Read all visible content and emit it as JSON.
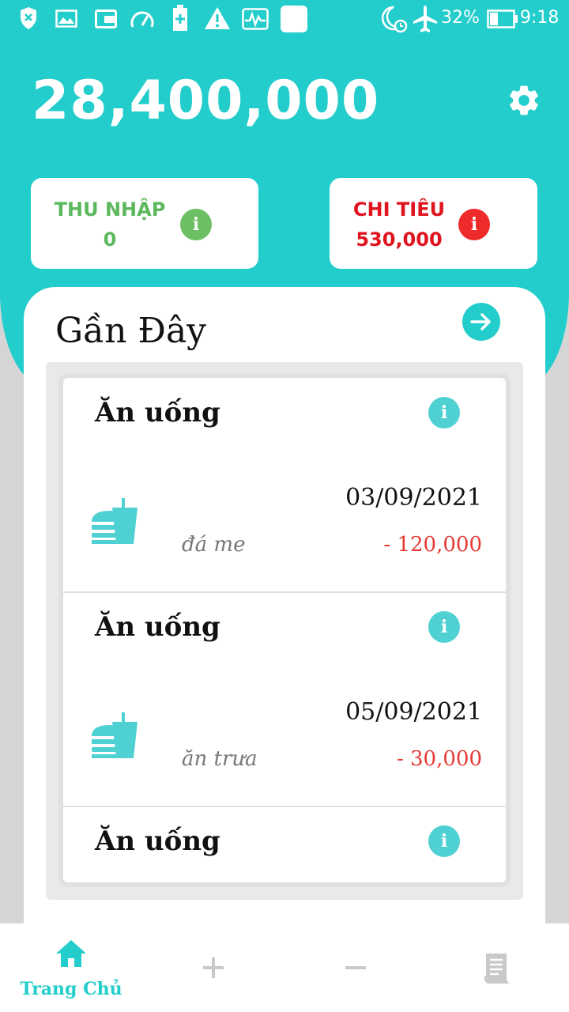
{
  "status_bar": {
    "battery_percent": "32%",
    "time": "9:18"
  },
  "balance": "28,400,000",
  "summary": {
    "income_label": "THU NHẬP",
    "income_value": "0",
    "income_color": "#5cb85c",
    "expense_label": "CHI TIÊU",
    "expense_value": "530,000",
    "expense_color": "#e0141e"
  },
  "recent": {
    "title": "Gần Đây",
    "items": [
      {
        "category": "Ăn uống",
        "date": "03/09/2021",
        "note": "đá me",
        "amount": "- 120,000"
      },
      {
        "category": "Ăn uống",
        "date": "05/09/2021",
        "note": "ăn trưa",
        "amount": "- 30,000"
      },
      {
        "category": "Ăn uống",
        "date": "",
        "note": "",
        "amount": ""
      }
    ]
  },
  "bottom_nav": {
    "home_label": "Trang Chủ"
  },
  "colors": {
    "accent": "#22cdcb",
    "expense_red": "#e53935"
  }
}
